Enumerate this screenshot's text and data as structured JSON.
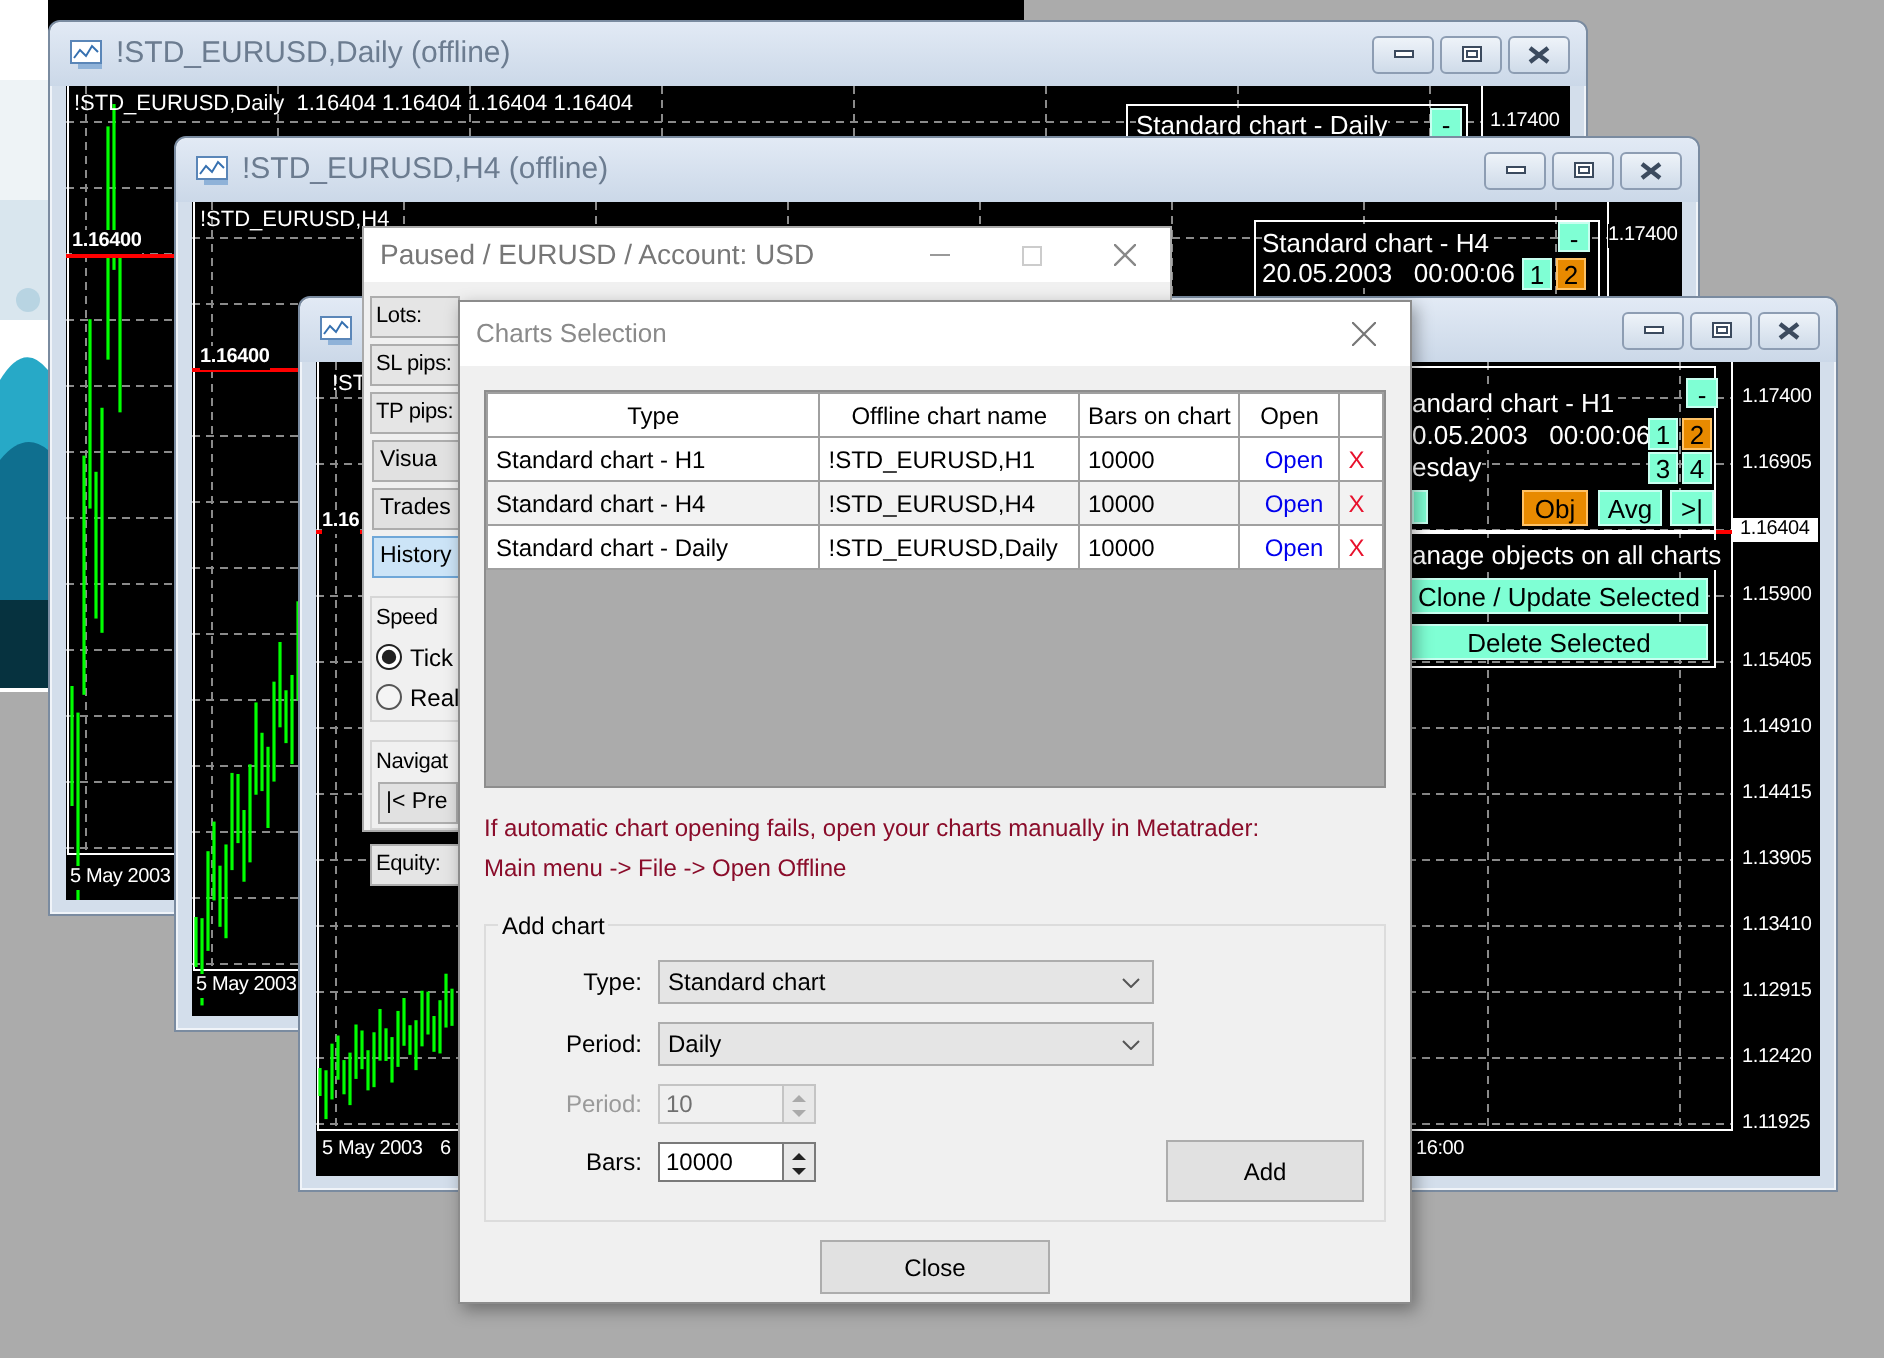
{
  "chart_windows": [
    {
      "title": "!STD_EURUSD,Daily (offline)",
      "header": "!STD_EURUSD,Daily  1.16404 1.16404 1.16404 1.16404",
      "panel": {
        "title": "Standard chart - Daily",
        "collapse": "-"
      },
      "price_labels": [
        {
          "text": "1.17400",
          "current": false
        }
      ],
      "line_label": "1.16400",
      "time_labels": [
        "5 May 2003"
      ]
    },
    {
      "title": "!STD_EURUSD,H4 (offline)",
      "header": "!STD_EURUSD,H4",
      "panel": {
        "title": "Standard chart - H4",
        "collapse": "-",
        "date": "20.05.2003   00:00:06",
        "slots": [
          {
            "label": "1",
            "selected": false
          },
          {
            "label": "2",
            "selected": true
          }
        ]
      },
      "price_labels": [
        {
          "text": "1.17400",
          "current": false
        }
      ],
      "line_label": "1.16400",
      "time_labels": [
        "5 May 2003"
      ]
    },
    {
      "header": "!ST",
      "panel": {
        "title": "andard chart - H1",
        "collapse": "-",
        "date": "0.05.2003   00:00:06",
        "day": "esday",
        "slots": [
          {
            "label": "1",
            "selected": false
          },
          {
            "label": "2",
            "selected": true
          },
          {
            "label": "3",
            "selected": false
          },
          {
            "label": "4",
            "selected": false
          }
        ],
        "tools": [
          {
            "label": "Obj",
            "selected": true
          },
          {
            "label": "Avg",
            "selected": false
          },
          {
            "label": ">|",
            "selected": false
          }
        ],
        "objects_caption": "anage objects on all charts",
        "object_buttons": [
          "Clone / Update Selected",
          "Delete Selected"
        ]
      },
      "price_labels": [
        {
          "text": "1.17400",
          "current": false
        },
        {
          "text": "1.16905",
          "current": false
        },
        {
          "text": "1.16404",
          "current": true
        },
        {
          "text": "1.15900",
          "current": false
        },
        {
          "text": "1.15405",
          "current": false
        },
        {
          "text": "1.14910",
          "current": false
        },
        {
          "text": "1.14415",
          "current": false
        },
        {
          "text": "1.13905",
          "current": false
        },
        {
          "text": "1.13410",
          "current": false
        },
        {
          "text": "1.12915",
          "current": false
        },
        {
          "text": "1.12420",
          "current": false
        },
        {
          "text": "1.11925",
          "current": false
        }
      ],
      "line_label": "1.16",
      "time_labels": [
        "5 May 2003",
        "6",
        "16:00"
      ]
    }
  ],
  "tester": {
    "title": "Paused / EURUSD / Account: USD",
    "fields": [
      "Lots:",
      "SL pips:",
      "TP pips:"
    ],
    "tabs": [
      {
        "label": "Visua",
        "selected": false
      },
      {
        "label": "Trades",
        "selected": false
      },
      {
        "label": "History",
        "selected": true
      }
    ],
    "speed": {
      "label": "Speed",
      "options": [
        {
          "label": "Tick",
          "selected": true
        },
        {
          "label": "Real",
          "selected": false
        }
      ]
    },
    "navigation": {
      "label": "Navigat",
      "button": "|< Pre"
    },
    "equity": "Equity:"
  },
  "dialog": {
    "title": "Charts Selection",
    "columns": [
      "Type",
      "Offline chart name",
      "Bars on chart",
      "Open"
    ],
    "rows": [
      {
        "type": "Standard chart - H1",
        "name": "!STD_EURUSD,H1",
        "bars": "10000",
        "open": "Open",
        "remove": "X"
      },
      {
        "type": "Standard chart - H4",
        "name": "!STD_EURUSD,H4",
        "bars": "10000",
        "open": "Open",
        "remove": "X"
      },
      {
        "type": "Standard chart - Daily",
        "name": "!STD_EURUSD,Daily",
        "bars": "10000",
        "open": "Open",
        "remove": "X"
      }
    ],
    "note": [
      "If automatic chart opening fails, open your charts manually in Metatrader:",
      "Main menu -> File -> Open Offline"
    ],
    "add_chart": {
      "legend": "Add chart",
      "type": {
        "label": "Type:",
        "value": "Standard chart"
      },
      "period": {
        "label": "Period:",
        "value": "Daily"
      },
      "period_count": {
        "label": "Period:",
        "value": "10",
        "disabled": true
      },
      "bars": {
        "label": "Bars:",
        "value": "10000"
      },
      "add_button": "Add"
    },
    "close_button": "Close"
  }
}
